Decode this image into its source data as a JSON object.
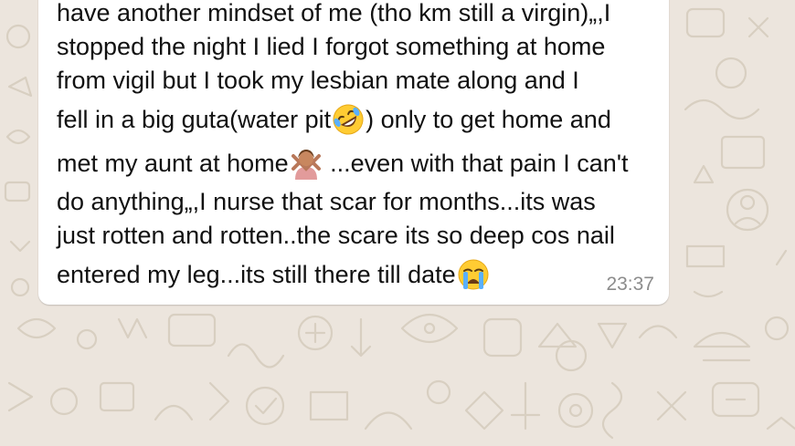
{
  "chat": {
    "background_color": "#ece5dd",
    "doodle_color": "#d9d1c3"
  },
  "message": {
    "lines": [
      "have another mindset of me (tho km still a virgin)„,I",
      "stopped the night I lied I forgot something at home",
      "from vigil but I took my lesbian mate along and I",
      "fell in a big guta(water pit",
      ") only to get home and",
      "met my aunt at home",
      " ...even with that pain I can't",
      "do anything„,I nurse that scar for months...its was",
      "just rotten and rotten..the scare its so deep cos nail",
      "entered my leg...its still there till date"
    ],
    "emojis": [
      "rolling-on-floor-laughing-emoji",
      "person-gesturing-no-emoji",
      "loudly-crying-face-emoji"
    ],
    "timestamp": "23:37",
    "bubble_color": "#ffffff"
  }
}
